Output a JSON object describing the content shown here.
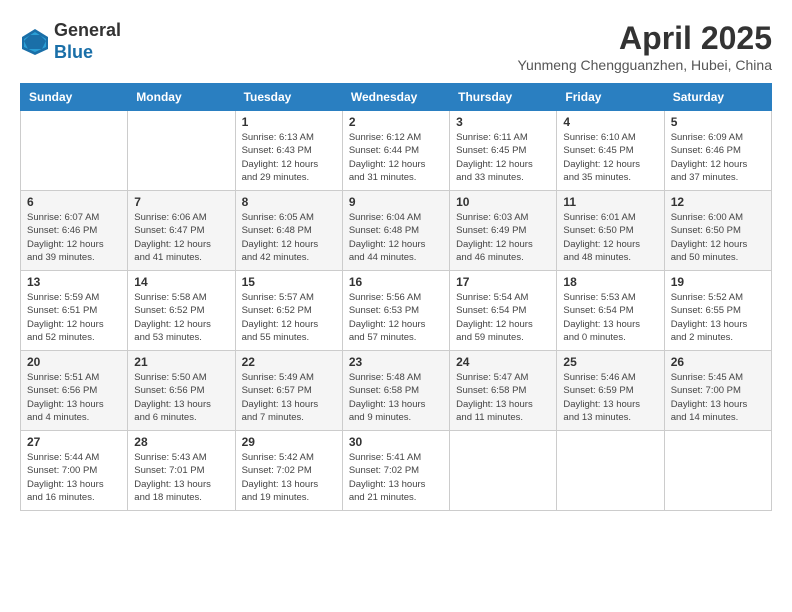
{
  "header": {
    "logo_line1": "General",
    "logo_line2": "Blue",
    "month_year": "April 2025",
    "location": "Yunmeng Chengguanzhen, Hubei, China"
  },
  "days_of_week": [
    "Sunday",
    "Monday",
    "Tuesday",
    "Wednesday",
    "Thursday",
    "Friday",
    "Saturday"
  ],
  "weeks": [
    [
      {
        "day": "",
        "info": ""
      },
      {
        "day": "",
        "info": ""
      },
      {
        "day": "1",
        "info": "Sunrise: 6:13 AM\nSunset: 6:43 PM\nDaylight: 12 hours\nand 29 minutes."
      },
      {
        "day": "2",
        "info": "Sunrise: 6:12 AM\nSunset: 6:44 PM\nDaylight: 12 hours\nand 31 minutes."
      },
      {
        "day": "3",
        "info": "Sunrise: 6:11 AM\nSunset: 6:45 PM\nDaylight: 12 hours\nand 33 minutes."
      },
      {
        "day": "4",
        "info": "Sunrise: 6:10 AM\nSunset: 6:45 PM\nDaylight: 12 hours\nand 35 minutes."
      },
      {
        "day": "5",
        "info": "Sunrise: 6:09 AM\nSunset: 6:46 PM\nDaylight: 12 hours\nand 37 minutes."
      }
    ],
    [
      {
        "day": "6",
        "info": "Sunrise: 6:07 AM\nSunset: 6:46 PM\nDaylight: 12 hours\nand 39 minutes."
      },
      {
        "day": "7",
        "info": "Sunrise: 6:06 AM\nSunset: 6:47 PM\nDaylight: 12 hours\nand 41 minutes."
      },
      {
        "day": "8",
        "info": "Sunrise: 6:05 AM\nSunset: 6:48 PM\nDaylight: 12 hours\nand 42 minutes."
      },
      {
        "day": "9",
        "info": "Sunrise: 6:04 AM\nSunset: 6:48 PM\nDaylight: 12 hours\nand 44 minutes."
      },
      {
        "day": "10",
        "info": "Sunrise: 6:03 AM\nSunset: 6:49 PM\nDaylight: 12 hours\nand 46 minutes."
      },
      {
        "day": "11",
        "info": "Sunrise: 6:01 AM\nSunset: 6:50 PM\nDaylight: 12 hours\nand 48 minutes."
      },
      {
        "day": "12",
        "info": "Sunrise: 6:00 AM\nSunset: 6:50 PM\nDaylight: 12 hours\nand 50 minutes."
      }
    ],
    [
      {
        "day": "13",
        "info": "Sunrise: 5:59 AM\nSunset: 6:51 PM\nDaylight: 12 hours\nand 52 minutes."
      },
      {
        "day": "14",
        "info": "Sunrise: 5:58 AM\nSunset: 6:52 PM\nDaylight: 12 hours\nand 53 minutes."
      },
      {
        "day": "15",
        "info": "Sunrise: 5:57 AM\nSunset: 6:52 PM\nDaylight: 12 hours\nand 55 minutes."
      },
      {
        "day": "16",
        "info": "Sunrise: 5:56 AM\nSunset: 6:53 PM\nDaylight: 12 hours\nand 57 minutes."
      },
      {
        "day": "17",
        "info": "Sunrise: 5:54 AM\nSunset: 6:54 PM\nDaylight: 12 hours\nand 59 minutes."
      },
      {
        "day": "18",
        "info": "Sunrise: 5:53 AM\nSunset: 6:54 PM\nDaylight: 13 hours\nand 0 minutes."
      },
      {
        "day": "19",
        "info": "Sunrise: 5:52 AM\nSunset: 6:55 PM\nDaylight: 13 hours\nand 2 minutes."
      }
    ],
    [
      {
        "day": "20",
        "info": "Sunrise: 5:51 AM\nSunset: 6:56 PM\nDaylight: 13 hours\nand 4 minutes."
      },
      {
        "day": "21",
        "info": "Sunrise: 5:50 AM\nSunset: 6:56 PM\nDaylight: 13 hours\nand 6 minutes."
      },
      {
        "day": "22",
        "info": "Sunrise: 5:49 AM\nSunset: 6:57 PM\nDaylight: 13 hours\nand 7 minutes."
      },
      {
        "day": "23",
        "info": "Sunrise: 5:48 AM\nSunset: 6:58 PM\nDaylight: 13 hours\nand 9 minutes."
      },
      {
        "day": "24",
        "info": "Sunrise: 5:47 AM\nSunset: 6:58 PM\nDaylight: 13 hours\nand 11 minutes."
      },
      {
        "day": "25",
        "info": "Sunrise: 5:46 AM\nSunset: 6:59 PM\nDaylight: 13 hours\nand 13 minutes."
      },
      {
        "day": "26",
        "info": "Sunrise: 5:45 AM\nSunset: 7:00 PM\nDaylight: 13 hours\nand 14 minutes."
      }
    ],
    [
      {
        "day": "27",
        "info": "Sunrise: 5:44 AM\nSunset: 7:00 PM\nDaylight: 13 hours\nand 16 minutes."
      },
      {
        "day": "28",
        "info": "Sunrise: 5:43 AM\nSunset: 7:01 PM\nDaylight: 13 hours\nand 18 minutes."
      },
      {
        "day": "29",
        "info": "Sunrise: 5:42 AM\nSunset: 7:02 PM\nDaylight: 13 hours\nand 19 minutes."
      },
      {
        "day": "30",
        "info": "Sunrise: 5:41 AM\nSunset: 7:02 PM\nDaylight: 13 hours\nand 21 minutes."
      },
      {
        "day": "",
        "info": ""
      },
      {
        "day": "",
        "info": ""
      },
      {
        "day": "",
        "info": ""
      }
    ]
  ]
}
